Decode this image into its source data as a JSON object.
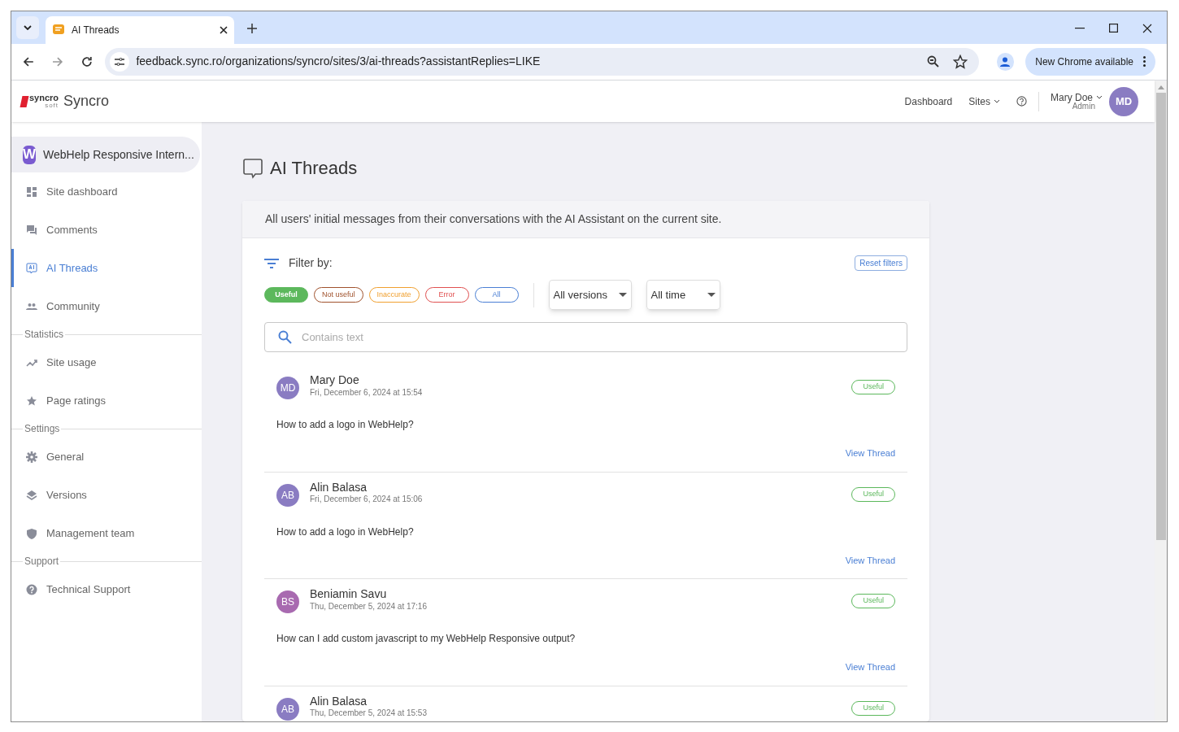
{
  "browser": {
    "tab_title": "AI Threads",
    "url": "feedback.sync.ro/organizations/syncro/sites/3/ai-threads?assistantReplies=LIKE",
    "update_button": "New Chrome available"
  },
  "header": {
    "logo": {
      "top": "syncro",
      "bottom": "soft"
    },
    "brand": "Syncro",
    "nav": [
      "Dashboard",
      "Sites"
    ],
    "user": {
      "name": "Mary Doe",
      "role": "Admin",
      "initials": "MD"
    }
  },
  "sidebar": {
    "site": {
      "letter": "W",
      "name": "WebHelp Responsive Intern..."
    },
    "items": [
      {
        "kind": "item",
        "label": "Site dashboard",
        "selected": false
      },
      {
        "kind": "item",
        "label": "Comments",
        "selected": false
      },
      {
        "kind": "item",
        "label": "AI Threads",
        "selected": true
      },
      {
        "kind": "item",
        "label": "Community",
        "selected": false
      },
      {
        "kind": "section",
        "label": "Statistics"
      },
      {
        "kind": "item",
        "label": "Site usage",
        "selected": false
      },
      {
        "kind": "item",
        "label": "Page ratings",
        "selected": false
      },
      {
        "kind": "section",
        "label": "Settings"
      },
      {
        "kind": "item",
        "label": "General",
        "selected": false
      },
      {
        "kind": "item",
        "label": "Versions",
        "selected": false
      },
      {
        "kind": "item",
        "label": "Management team",
        "selected": false
      },
      {
        "kind": "section",
        "label": "Support"
      },
      {
        "kind": "item",
        "label": "Technical Support",
        "selected": false
      }
    ]
  },
  "page": {
    "title": "AI Threads",
    "description": "All users' initial messages from their conversations with the AI Assistant on the current site.",
    "filter_label": "Filter by:",
    "reset_button": "Reset filters",
    "filters": [
      {
        "label": "Useful",
        "color": "#5cb85c",
        "selected": true
      },
      {
        "label": "Not useful",
        "color": "#a0522d",
        "selected": false
      },
      {
        "label": "Inaccurate",
        "color": "#f0a030",
        "selected": false
      },
      {
        "label": "Error",
        "color": "#e05050",
        "selected": false
      },
      {
        "label": "All",
        "color": "#4a7fd4",
        "selected": false
      }
    ],
    "dropdowns": [
      "All versions",
      "All time"
    ],
    "search": {
      "placeholder": "Contains text"
    },
    "threads": [
      {
        "initials": "MD",
        "color": "#8a7cc2",
        "name": "Mary Doe",
        "date": "Fri, December 6, 2024 at 15:54",
        "badge": "Useful",
        "message": "How to add a logo in WebHelp?",
        "link": "View Thread"
      },
      {
        "initials": "AB",
        "color": "#8a7cc2",
        "name": "Alin Balasa",
        "date": "Fri, December 6, 2024 at 15:06",
        "badge": "Useful",
        "message": "How to add a logo in WebHelp?",
        "link": "View Thread"
      },
      {
        "initials": "BS",
        "color": "#a86ab0",
        "name": "Beniamin Savu",
        "date": "Thu, December 5, 2024 at 17:16",
        "badge": "Useful",
        "message": "How can I add custom javascript to my WebHelp Responsive output?",
        "link": "View Thread"
      },
      {
        "initials": "AB",
        "color": "#8a7cc2",
        "name": "Alin Balasa",
        "date": "Thu, December 5, 2024 at 15:53",
        "badge": "Useful"
      }
    ]
  }
}
